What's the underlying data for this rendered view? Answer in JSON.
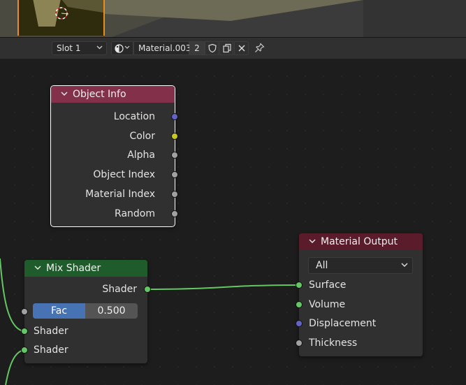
{
  "header": {
    "slot_label": "Slot 1",
    "material_name": "Material.003",
    "user_count": "2"
  },
  "nodes": {
    "object_info": {
      "title": "Object Info",
      "outputs": [
        "Location",
        "Color",
        "Alpha",
        "Object Index",
        "Material Index",
        "Random"
      ]
    },
    "mix_shader": {
      "title": "Mix Shader",
      "output": "Shader",
      "fac_label": "Fac",
      "fac_value": "0.500",
      "fac_fraction": 0.5,
      "inputs": [
        "Shader",
        "Shader"
      ]
    },
    "material_output": {
      "title": "Material Output",
      "target": "All",
      "inputs": [
        "Surface",
        "Volume",
        "Displacement",
        "Thickness"
      ]
    }
  },
  "colors": {
    "object_info_header": "#83314a",
    "mix_shader_header": "#1f5c2b",
    "material_output_header": "#5a1b2b",
    "shader_socket": "#63c763",
    "vector_socket": "#6363c7",
    "color_socket": "#c7c729",
    "float_socket": "#a1a1a1",
    "selection_outline": "#e98e1b",
    "fac_fill": "#4772b3"
  },
  "icons": [
    "3d-cursor-icon",
    "chevron-down-icon",
    "material-sphere-icon",
    "fake-user-shield-icon",
    "duplicate-icon",
    "close-icon",
    "pin-icon"
  ]
}
